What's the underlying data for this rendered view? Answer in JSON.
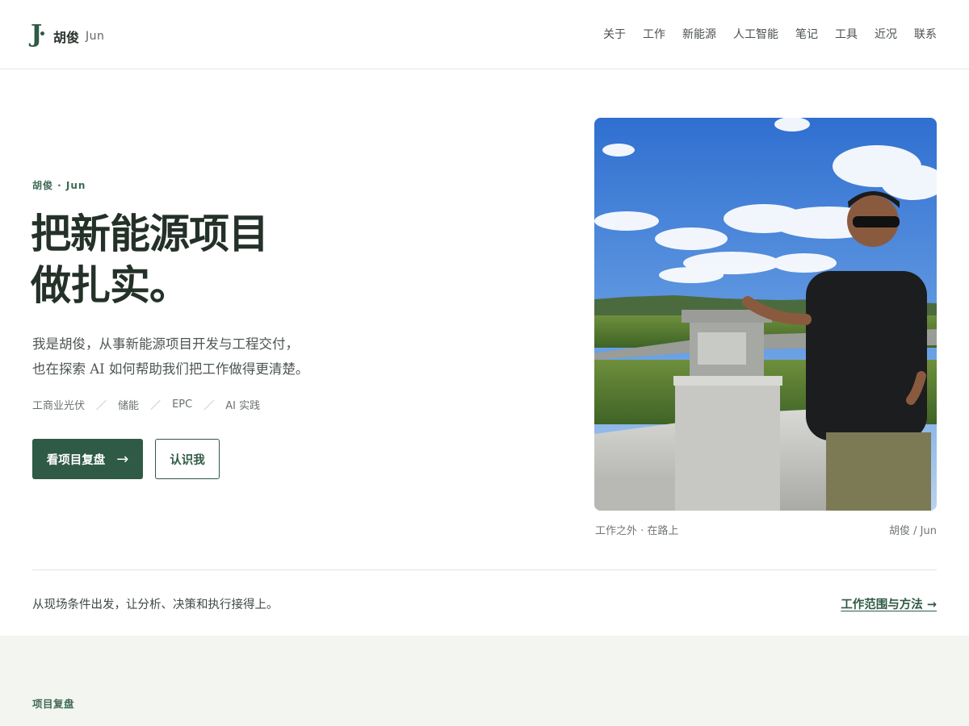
{
  "header": {
    "logo_letter": "J",
    "name": "胡俊",
    "name_en": "Jun",
    "nav": [
      "关于",
      "工作",
      "新能源",
      "人工智能",
      "笔记",
      "工具",
      "近况",
      "联系"
    ]
  },
  "hero": {
    "eyebrow": "胡俊 · Jun",
    "title_lines": [
      "把新能源项目",
      "做扎实。"
    ],
    "intro_lines": [
      "我是胡俊，从事新能源项目开发与工程交付，",
      "也在探索 AI 如何帮助我们把工作做得更清楚。"
    ],
    "tags": [
      "工商业光伏",
      "储能",
      "EPC",
      "AI 实践"
    ],
    "tag_separator": "／",
    "primary_button": "看项目复盘",
    "primary_button_arrow": "→",
    "secondary_button": "认识我"
  },
  "photo": {
    "caption_left": "工作之外 · 在路上",
    "caption_right": "胡俊 / Jun"
  },
  "strip": {
    "text": "从现场条件出发，让分析、决策和执行接得上。",
    "link": "工作范围与方法 →"
  },
  "section2": {
    "title": "项目复盘"
  },
  "colors": {
    "brand": "#2f5a45",
    "section_bg": "#f3f5f1"
  }
}
